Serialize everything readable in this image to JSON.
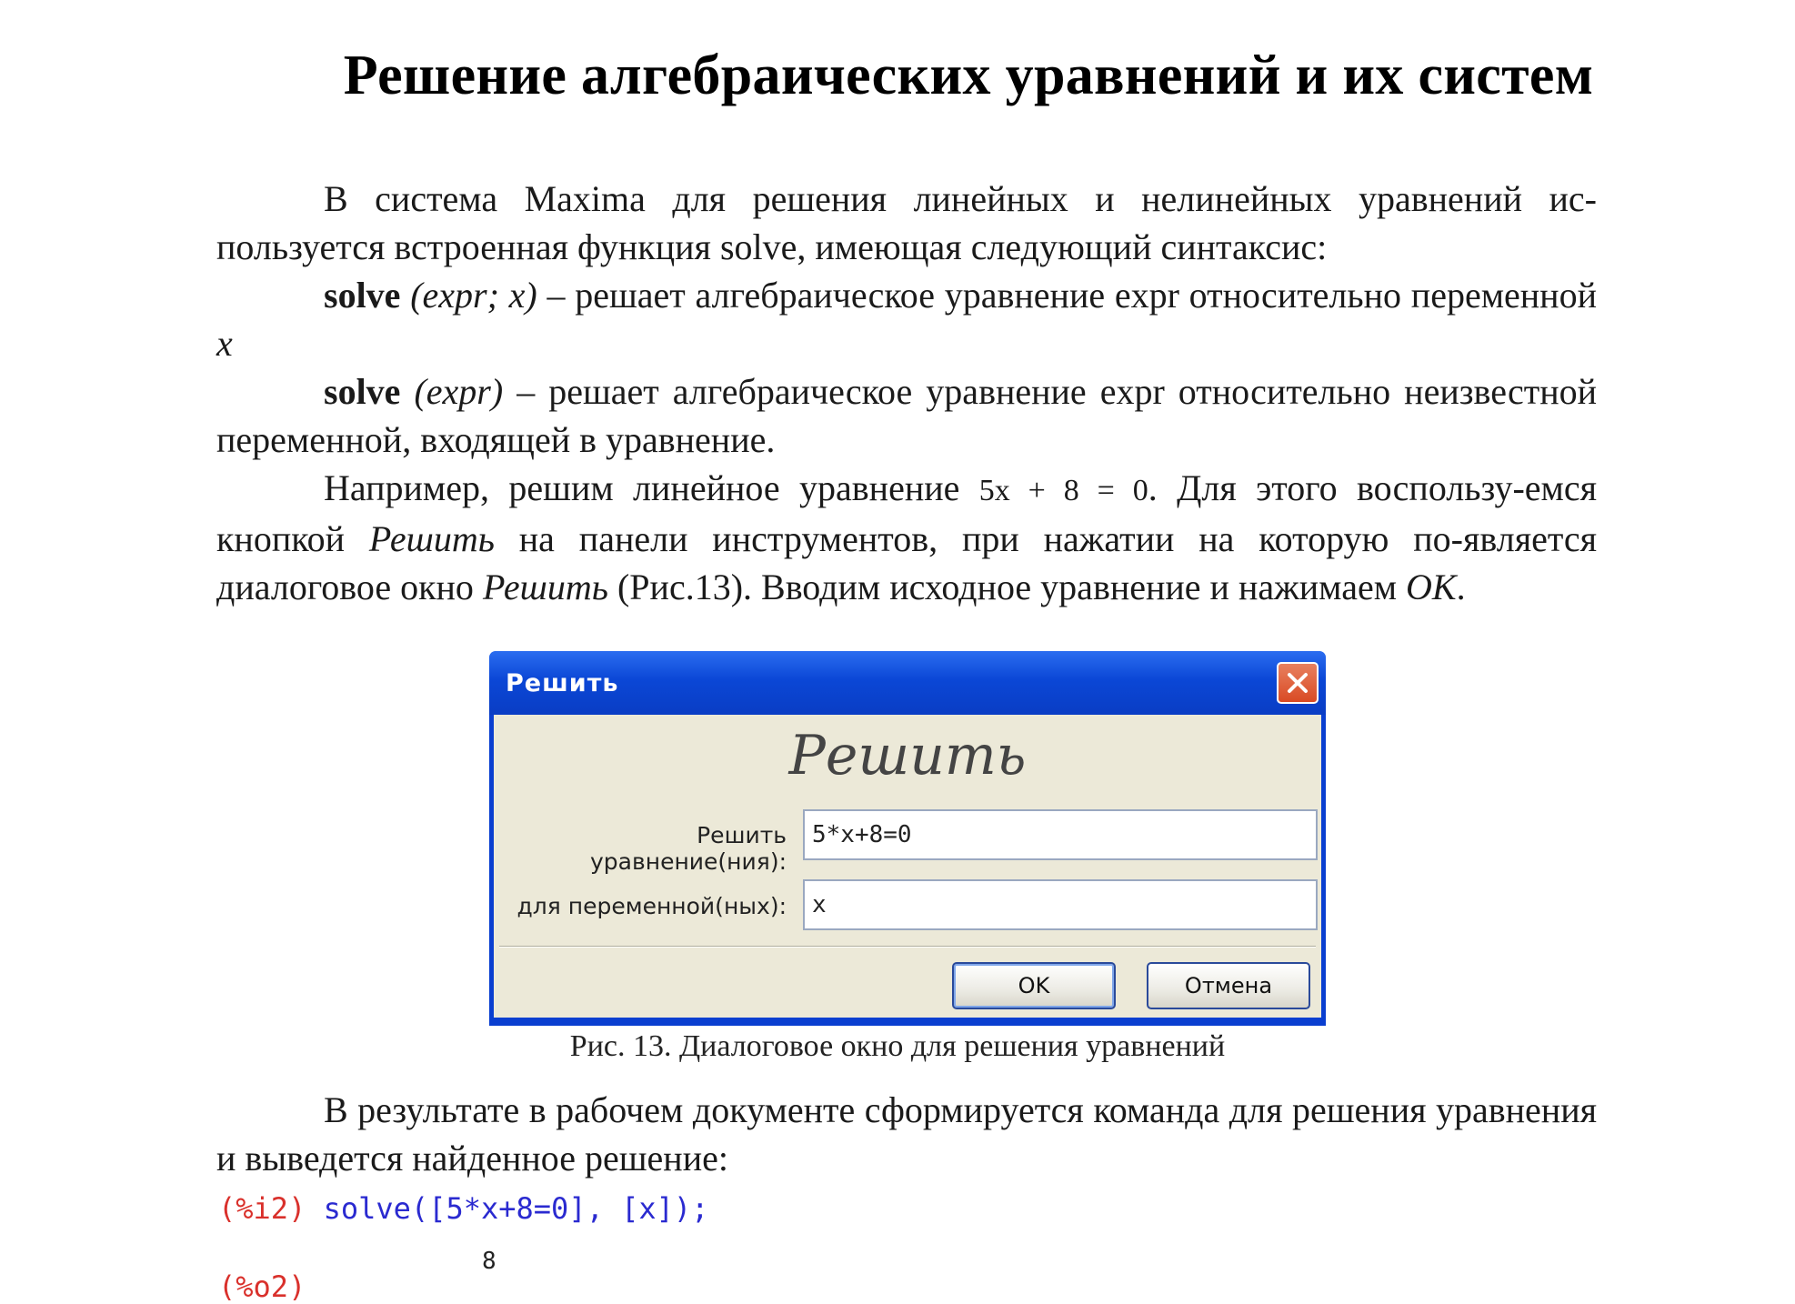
{
  "title": "Решение алгебраических уравнений и их систем",
  "p1": {
    "a": "В система Maxima для решения линейных и нелинейных уравнений ис-пользуется встроенная функция solve, имеющая следующий синтаксис:"
  },
  "p2": {
    "func": "solve",
    "args": "(expr; x)",
    "desc": " – решает алгебраическое уравнение expr относительно переменной ",
    "var": "x"
  },
  "p3": {
    "func": "solve",
    "args": "(expr)",
    "desc": " – решает алгебраическое уравнение expr относительно неизвестной переменной, входящей в уравнение."
  },
  "p4": {
    "a": "Например, решим линейное уравнение ",
    "eq": "5x + 8 = 0",
    "b": ". Для этого воспользу-емся кнопкой ",
    "btn1": "Решить",
    "c": " на панели инструментов, при нажатии на которую по-является диалоговое окно ",
    "btn2": "Решить",
    "d": " (Рис.13). Вводим исходное уравнение и нажимаем ",
    "ok": "OK",
    "e": "."
  },
  "dialog": {
    "window_title": "Решить",
    "heading": "Решить",
    "label_equation": "Решить уравнение(ния):",
    "value_equation": "5*x+8=0",
    "label_variable": "для переменной(ных):",
    "value_variable": "x",
    "ok_label": "OK",
    "cancel_label": "Отмена"
  },
  "caption": "Рис. 13. Диалоговое окно для решения уравнений",
  "p5": "В результате в рабочем документе сформируется команда для решения уравнения и выведется найденное решение:",
  "code": {
    "prompt": "(%i2)",
    "command": "solve([5*x+8=0], [x]);",
    "fraction_numerator": "8",
    "output_prompt": "(%o2)"
  }
}
